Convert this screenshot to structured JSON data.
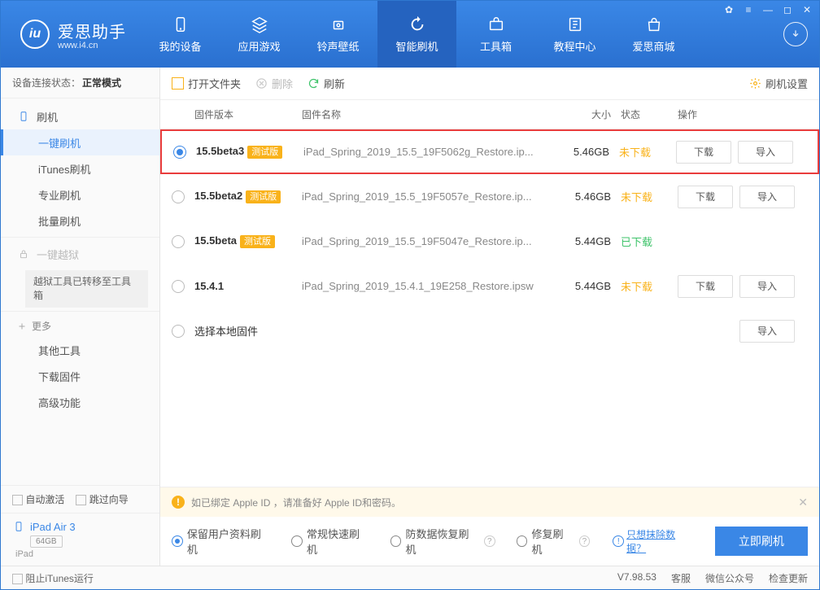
{
  "brand": {
    "title": "爱思助手",
    "url": "www.i4.cn",
    "logo_letter": "iu"
  },
  "sys_icons": [
    "✿",
    "≡",
    "—",
    "◻",
    "✕"
  ],
  "topnav": [
    {
      "label": "我的设备",
      "icon": "device"
    },
    {
      "label": "应用游戏",
      "icon": "apps"
    },
    {
      "label": "铃声壁纸",
      "icon": "ringtone"
    },
    {
      "label": "智能刷机",
      "icon": "flash",
      "active": true
    },
    {
      "label": "工具箱",
      "icon": "toolbox"
    },
    {
      "label": "教程中心",
      "icon": "tutorial"
    },
    {
      "label": "爱思商城",
      "icon": "store"
    }
  ],
  "sidebar": {
    "status_label": "设备连接状态：",
    "status_value": "正常模式",
    "flash_group": "刷机",
    "items1": [
      "一键刷机",
      "iTunes刷机",
      "专业刷机",
      "批量刷机"
    ],
    "active_item": "一键刷机",
    "jailbreak": "一键越狱",
    "jailbreak_note": "越狱工具已转移至工具箱",
    "more_group": "更多",
    "items2": [
      "其他工具",
      "下载固件",
      "高级功能"
    ],
    "auto_activate": "自动激活",
    "skip_guide": "跳过向导",
    "device_name": "iPad Air 3",
    "device_cap": "64GB",
    "device_type": "iPad"
  },
  "toolbar": {
    "open_folder": "打开文件夹",
    "delete": "删除",
    "refresh": "刷新",
    "settings": "刷机设置"
  },
  "table": {
    "h_version": "固件版本",
    "h_name": "固件名称",
    "h_size": "大小",
    "h_status": "状态",
    "h_op": "操作",
    "download_btn": "下载",
    "import_btn": "导入",
    "beta_badge": "测试版",
    "local_fw": "选择本地固件",
    "rows": [
      {
        "ver": "15.5beta3",
        "beta": true,
        "name": "iPad_Spring_2019_15.5_19F5062g_Restore.ip...",
        "size": "5.46GB",
        "status": "未下载",
        "status_cls": "st-dl",
        "selected": true,
        "highlight": true,
        "ops": [
          "download",
          "import"
        ]
      },
      {
        "ver": "15.5beta2",
        "beta": true,
        "name": "iPad_Spring_2019_15.5_19F5057e_Restore.ip...",
        "size": "5.46GB",
        "status": "未下载",
        "status_cls": "st-dl",
        "ops": [
          "download",
          "import"
        ]
      },
      {
        "ver": "15.5beta",
        "beta": true,
        "name": "iPad_Spring_2019_15.5_19F5047e_Restore.ip...",
        "size": "5.44GB",
        "status": "已下载",
        "status_cls": "st-ok",
        "ops": []
      },
      {
        "ver": "15.4.1",
        "beta": false,
        "name": "iPad_Spring_2019_15.4.1_19E258_Restore.ipsw",
        "size": "5.44GB",
        "status": "未下载",
        "status_cls": "st-dl",
        "ops": [
          "download",
          "import"
        ]
      }
    ]
  },
  "warn_text": "如已绑定 Apple ID ，请准备好 Apple ID和密码。",
  "flash_opts": {
    "opt1": "保留用户资料刷机",
    "opt2": "常规快速刷机",
    "opt3": "防数据恢复刷机",
    "opt4": "修复刷机",
    "erase_link": "只想抹除数据？",
    "flash_btn": "立即刷机"
  },
  "footer": {
    "block_itunes": "阻止iTunes运行",
    "version": "V7.98.53",
    "service": "客服",
    "wechat": "微信公众号",
    "check_update": "检查更新"
  }
}
